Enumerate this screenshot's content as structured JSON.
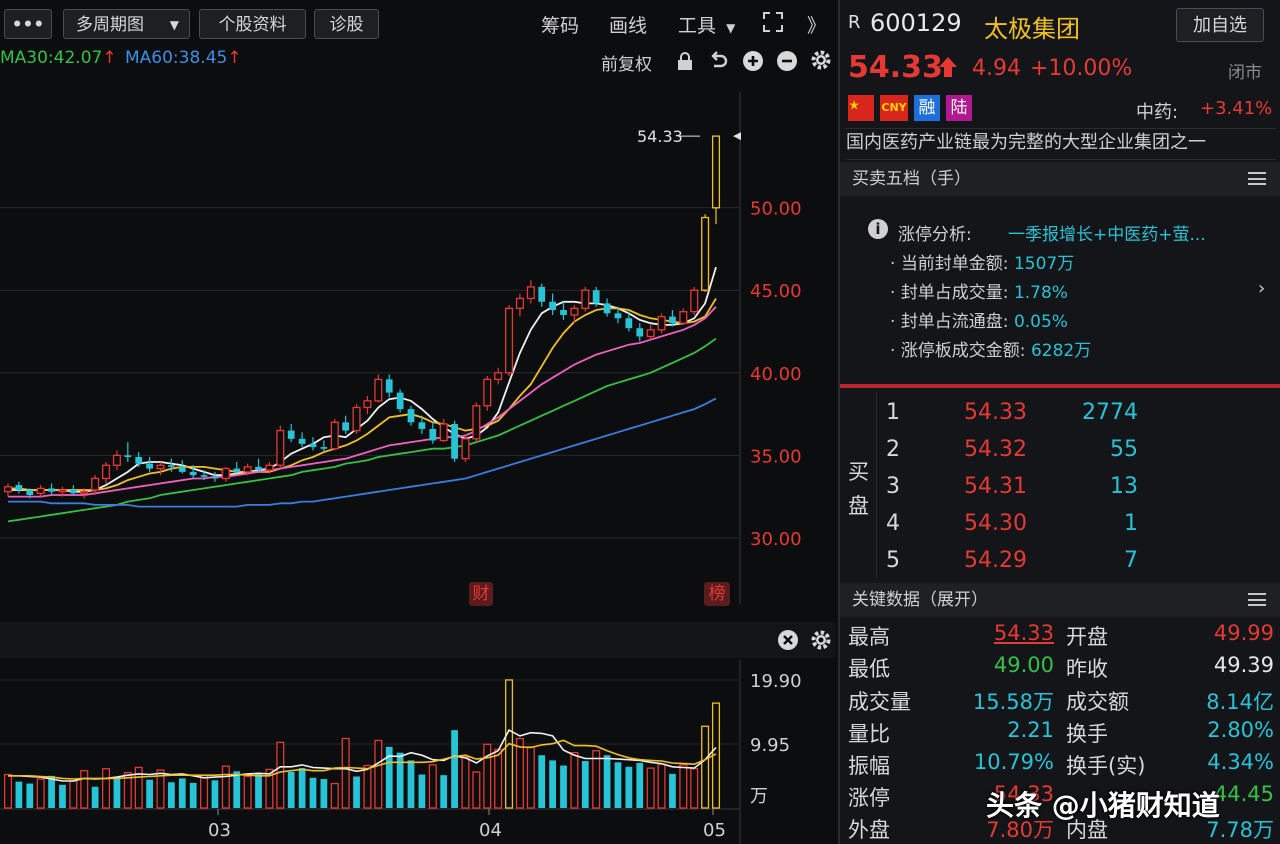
{
  "toolbar": {
    "more_label": "•••",
    "period_label": "多周期图",
    "stock_info_label": "个股资料",
    "diagnose_label": "诊股",
    "chips_label": "筹码",
    "draw_label": "画线",
    "tools_label": "工具",
    "expand_label": "》"
  },
  "ma_legend": {
    "ma30": "MA30:42.07",
    "ma60": "MA60:38.45"
  },
  "chart_controls": {
    "adjust_label": "前复权"
  },
  "markers": {
    "cai": "财",
    "bang": "榜"
  },
  "chart_data": [
    {
      "type": "candlestick",
      "title": "",
      "ylim": [
        26,
        57
      ],
      "y_ticks": [
        "30.00",
        "35.00",
        "40.00",
        "45.00",
        "50.00"
      ],
      "last_price_label": "54.33",
      "candles": [
        [
          32.8,
          33.3,
          32.5,
          33.1
        ],
        [
          33.2,
          33.4,
          32.7,
          32.9
        ],
        [
          32.9,
          33.0,
          32.4,
          32.6
        ],
        [
          32.7,
          33.2,
          32.5,
          33.0
        ],
        [
          33.0,
          33.3,
          32.6,
          32.8
        ],
        [
          32.8,
          33.1,
          32.5,
          32.9
        ],
        [
          32.9,
          33.2,
          32.6,
          32.7
        ],
        [
          32.7,
          33.0,
          32.4,
          32.8
        ],
        [
          32.9,
          33.8,
          32.6,
          33.6
        ],
        [
          33.6,
          34.6,
          33.3,
          34.4
        ],
        [
          34.4,
          35.3,
          34.1,
          35.0
        ],
        [
          35.0,
          35.8,
          34.6,
          34.9
        ],
        [
          34.9,
          35.2,
          34.3,
          34.5
        ],
        [
          34.5,
          34.9,
          34.0,
          34.2
        ],
        [
          34.2,
          34.6,
          33.8,
          34.4
        ],
        [
          34.4,
          34.8,
          34.0,
          34.3
        ],
        [
          34.3,
          34.7,
          33.9,
          34.0
        ],
        [
          34.0,
          34.4,
          33.6,
          33.8
        ],
        [
          33.8,
          34.1,
          33.5,
          33.7
        ],
        [
          33.7,
          34.0,
          33.4,
          33.6
        ],
        [
          33.6,
          34.3,
          33.4,
          34.2
        ],
        [
          34.2,
          34.6,
          33.9,
          34.0
        ],
        [
          34.0,
          34.5,
          33.8,
          34.3
        ],
        [
          34.3,
          34.8,
          34.0,
          34.1
        ],
        [
          34.1,
          34.6,
          33.9,
          34.4
        ],
        [
          34.4,
          36.8,
          34.2,
          36.5
        ],
        [
          36.5,
          36.9,
          35.8,
          36.0
        ],
        [
          36.0,
          36.4,
          35.5,
          35.7
        ],
        [
          35.7,
          36.1,
          35.3,
          35.5
        ],
        [
          35.5,
          35.9,
          35.2,
          35.4
        ],
        [
          35.4,
          37.2,
          35.3,
          37.0
        ],
        [
          37.0,
          37.4,
          36.3,
          36.5
        ],
        [
          36.5,
          38.1,
          36.3,
          37.9
        ],
        [
          37.9,
          38.6,
          37.5,
          38.3
        ],
        [
          38.3,
          39.9,
          38.2,
          39.6
        ],
        [
          39.6,
          39.9,
          38.5,
          38.8
        ],
        [
          38.8,
          39.0,
          37.6,
          37.8
        ],
        [
          37.8,
          38.0,
          36.8,
          37.0
        ],
        [
          37.0,
          37.4,
          36.3,
          36.6
        ],
        [
          36.6,
          37.0,
          35.7,
          35.9
        ],
        [
          35.9,
          37.2,
          35.8,
          36.9
        ],
        [
          36.9,
          37.1,
          34.6,
          34.8
        ],
        [
          34.8,
          36.2,
          34.6,
          36.0
        ],
        [
          36.0,
          38.2,
          35.8,
          38.0
        ],
        [
          38.0,
          39.8,
          37.7,
          39.6
        ],
        [
          39.6,
          40.3,
          39.3,
          40.0
        ],
        [
          40.0,
          44.1,
          39.8,
          43.9
        ],
        [
          43.9,
          44.8,
          43.4,
          44.5
        ],
        [
          44.5,
          45.6,
          44.2,
          45.2
        ],
        [
          45.2,
          45.4,
          44.0,
          44.3
        ],
        [
          44.3,
          44.8,
          43.5,
          43.8
        ],
        [
          43.8,
          44.3,
          43.2,
          43.5
        ],
        [
          43.5,
          44.1,
          43.0,
          43.9
        ],
        [
          43.9,
          45.2,
          43.7,
          45.0
        ],
        [
          45.0,
          45.2,
          44.0,
          44.2
        ],
        [
          44.2,
          44.5,
          43.4,
          43.6
        ],
        [
          43.6,
          44.0,
          43.0,
          43.3
        ],
        [
          43.3,
          43.7,
          42.5,
          42.7
        ],
        [
          42.7,
          43.0,
          41.9,
          42.2
        ],
        [
          42.2,
          42.9,
          42.0,
          42.6
        ],
        [
          42.6,
          43.6,
          42.4,
          43.4
        ],
        [
          43.4,
          43.8,
          42.8,
          43.0
        ],
        [
          43.0,
          43.9,
          42.9,
          43.7
        ],
        [
          43.7,
          45.2,
          43.5,
          45.0
        ],
        [
          45.0,
          49.6,
          44.9,
          49.4
        ],
        [
          49.99,
          54.33,
          49.0,
          54.33
        ]
      ],
      "series": [
        {
          "name": "MA5",
          "color": "#f0f0f0",
          "values": [
            32.9,
            32.9,
            32.9,
            32.9,
            32.9,
            32.9,
            32.8,
            32.8,
            32.9,
            33.2,
            33.6,
            34.0,
            34.5,
            34.6,
            34.6,
            34.5,
            34.4,
            34.2,
            34.0,
            33.8,
            33.8,
            33.9,
            34.0,
            34.1,
            34.2,
            34.6,
            35.1,
            35.4,
            35.7,
            36.1,
            36.2,
            36.1,
            36.6,
            37.1,
            37.9,
            38.4,
            38.5,
            38.3,
            37.8,
            37.2,
            36.7,
            36.3,
            36.0,
            36.2,
            36.7,
            37.6,
            39.4,
            41.2,
            42.6,
            43.6,
            44.0,
            44.3,
            44.3,
            44.2,
            44.2,
            44.1,
            43.9,
            43.6,
            43.2,
            43.0,
            42.9,
            42.9,
            43.0,
            43.3,
            44.2,
            46.4
          ]
        },
        {
          "name": "MA10",
          "color": "#f0c020",
          "values": [
            33.0,
            33.0,
            32.9,
            32.9,
            32.9,
            32.9,
            32.9,
            32.9,
            32.9,
            33.0,
            33.2,
            33.5,
            33.7,
            33.9,
            34.0,
            34.2,
            34.3,
            34.3,
            34.3,
            34.2,
            34.1,
            34.0,
            34.0,
            34.0,
            34.0,
            34.2,
            34.4,
            34.7,
            34.9,
            35.2,
            35.4,
            35.6,
            35.9,
            36.3,
            36.8,
            37.3,
            37.4,
            37.5,
            37.3,
            37.0,
            36.9,
            36.7,
            36.5,
            36.6,
            36.8,
            37.1,
            37.8,
            38.6,
            39.3,
            40.4,
            41.5,
            42.4,
            43.1,
            43.5,
            43.8,
            43.9,
            43.9,
            43.8,
            43.5,
            43.3,
            43.2,
            43.1,
            43.0,
            43.1,
            43.4,
            44.5
          ]
        },
        {
          "name": "MA20",
          "color": "#f060c0",
          "values": [
            32.5,
            32.5,
            32.5,
            32.5,
            32.6,
            32.6,
            32.6,
            32.6,
            32.7,
            32.8,
            32.9,
            33.0,
            33.1,
            33.2,
            33.3,
            33.4,
            33.5,
            33.6,
            33.6,
            33.7,
            33.7,
            33.8,
            33.9,
            34.0,
            34.1,
            34.2,
            34.3,
            34.4,
            34.5,
            34.6,
            34.7,
            34.8,
            35.0,
            35.2,
            35.4,
            35.6,
            35.7,
            35.8,
            35.9,
            36.0,
            36.1,
            36.1,
            36.2,
            36.5,
            36.9,
            37.3,
            37.8,
            38.3,
            38.8,
            39.3,
            39.7,
            40.1,
            40.5,
            40.8,
            41.1,
            41.3,
            41.5,
            41.7,
            41.8,
            42.0,
            42.2,
            42.4,
            42.6,
            42.9,
            43.3,
            44.0
          ]
        },
        {
          "name": "MA30",
          "color": "#35c146",
          "values": [
            31.0,
            31.1,
            31.2,
            31.3,
            31.4,
            31.5,
            31.6,
            31.7,
            31.8,
            31.9,
            32.0,
            32.2,
            32.3,
            32.4,
            32.6,
            32.7,
            32.8,
            32.9,
            33.0,
            33.1,
            33.2,
            33.3,
            33.4,
            33.5,
            33.6,
            33.7,
            33.8,
            34.0,
            34.1,
            34.2,
            34.3,
            34.5,
            34.6,
            34.7,
            34.9,
            35.0,
            35.1,
            35.2,
            35.3,
            35.4,
            35.4,
            35.5,
            35.6,
            35.8,
            36.0,
            36.2,
            36.5,
            36.8,
            37.1,
            37.4,
            37.7,
            38.0,
            38.3,
            38.6,
            38.9,
            39.2,
            39.4,
            39.6,
            39.8,
            40.0,
            40.3,
            40.6,
            40.9,
            41.2,
            41.6,
            42.07
          ]
        },
        {
          "name": "MA60",
          "color": "#3a7de0",
          "values": [
            32.2,
            32.2,
            32.2,
            32.2,
            32.1,
            32.1,
            32.1,
            32.1,
            32.0,
            32.0,
            32.0,
            32.0,
            31.9,
            31.9,
            31.9,
            31.9,
            31.9,
            31.9,
            31.9,
            31.9,
            31.9,
            31.9,
            32.0,
            32.0,
            32.0,
            32.1,
            32.1,
            32.2,
            32.2,
            32.3,
            32.4,
            32.5,
            32.6,
            32.7,
            32.8,
            32.9,
            33.0,
            33.1,
            33.2,
            33.3,
            33.4,
            33.5,
            33.6,
            33.8,
            34.0,
            34.2,
            34.4,
            34.6,
            34.8,
            35.0,
            35.2,
            35.4,
            35.6,
            35.8,
            36.0,
            36.2,
            36.4,
            36.6,
            36.8,
            37.0,
            37.2,
            37.4,
            37.6,
            37.8,
            38.1,
            38.45
          ]
        }
      ]
    },
    {
      "type": "bar",
      "title": "",
      "ylim": [
        0,
        23
      ],
      "y_ticks": [
        "9.95",
        "19.90"
      ],
      "unit_label": "万",
      "x_ticks": [
        "03",
        "04",
        "05"
      ],
      "values": [
        5.2,
        4.1,
        3.8,
        4.5,
        5.0,
        3.6,
        4.2,
        5.8,
        3.3,
        6.1,
        4.8,
        5.5,
        6.3,
        4.4,
        5.9,
        4.0,
        4.6,
        3.9,
        5.1,
        4.3,
        6.5,
        5.7,
        4.9,
        5.3,
        6.0,
        10.2,
        5.6,
        6.2,
        4.7,
        4.5,
        3.8,
        10.8,
        4.9,
        6.6,
        10.5,
        9.5,
        8.6,
        7.4,
        5.2,
        6.7,
        5.1,
        12.1,
        7.9,
        5.6,
        9.9,
        9.1,
        19.9,
        10.8,
        9.5,
        8.2,
        7.4,
        6.6,
        8.6,
        7.3,
        8.9,
        8.2,
        7.1,
        6.4,
        7.0,
        6.2,
        6.8,
        5.3,
        6.7,
        6.1,
        12.7,
        16.3
      ],
      "up_flags": [
        1,
        0,
        0,
        1,
        0,
        0,
        1,
        1,
        0,
        1,
        0,
        1,
        1,
        0,
        1,
        0,
        0,
        0,
        1,
        0,
        1,
        0,
        1,
        0,
        1,
        1,
        0,
        0,
        0,
        0,
        1,
        1,
        0,
        1,
        1,
        0,
        0,
        0,
        0,
        1,
        0,
        0,
        1,
        1,
        1,
        1,
        1,
        1,
        1,
        0,
        0,
        0,
        1,
        0,
        1,
        0,
        0,
        0,
        0,
        1,
        1,
        0,
        1,
        1,
        1,
        1
      ],
      "series": [
        {
          "name": "VMA5",
          "color": "#f0f0f0",
          "values": [
            5.0,
            5.0,
            4.9,
            4.8,
            4.5,
            4.2,
            4.2,
            4.6,
            4.5,
            4.6,
            4.8,
            5.1,
            5.3,
            5.2,
            5.4,
            5.2,
            5.3,
            5.0,
            4.7,
            4.8,
            4.9,
            5.1,
            5.3,
            5.4,
            5.3,
            6.4,
            6.4,
            6.7,
            6.3,
            6.2,
            6.1,
            6.1,
            5.7,
            6.0,
            7.0,
            8.1,
            8.0,
            8.6,
            8.2,
            7.5,
            7.4,
            8.1,
            7.8,
            7.0,
            8.1,
            8.9,
            12.1,
            11.2,
            11.7,
            11.6,
            11.2,
            9.0,
            8.2,
            7.7,
            7.7,
            7.7,
            7.6,
            7.5,
            7.4,
            7.1,
            6.9,
            6.4,
            6.3,
            6.2,
            7.5,
            9.4
          ]
        },
        {
          "name": "VMA10",
          "color": "#f0c020",
          "values": [
            5.0,
            5.0,
            5.0,
            4.9,
            4.8,
            4.6,
            4.5,
            4.6,
            4.6,
            4.6,
            4.6,
            4.7,
            4.8,
            4.9,
            5.0,
            5.1,
            5.1,
            5.1,
            5.1,
            5.1,
            5.2,
            5.2,
            5.1,
            5.0,
            5.0,
            5.6,
            5.8,
            6.0,
            5.8,
            5.8,
            6.2,
            6.3,
            6.2,
            6.1,
            6.6,
            7.1,
            7.1,
            7.1,
            7.1,
            7.2,
            7.6,
            8.0,
            8.2,
            7.6,
            7.8,
            8.2,
            10.0,
            9.5,
            9.4,
            9.8,
            10.0,
            10.5,
            9.7,
            9.7,
            9.6,
            8.9,
            8.3,
            7.8,
            7.5,
            7.4,
            7.3,
            7.0,
            6.9,
            6.8,
            7.5,
            8.4
          ]
        }
      ]
    }
  ],
  "quote": {
    "r_label": "R",
    "code": "600129",
    "name": "太极集团",
    "add_watch_label": "加自选",
    "price": "54.33",
    "up_arrow": "🡅",
    "change": "4.94",
    "change_pct": "+10.00%",
    "status": "闭市",
    "tag_cny": "CNY",
    "tag_rong": "融",
    "tag_lu": "陆",
    "sector_label": "中药:",
    "sector_pct": "+3.41%",
    "description": "国内医药产业链最为完整的大型企业集团之一"
  },
  "orderbook": {
    "title": "买卖五档（手）",
    "limit_analysis": {
      "label": "涨停分析:",
      "reason": "一季报增长+中医药+萤...",
      "rows": [
        {
          "label": "当前封单金额:",
          "value": "1507万"
        },
        {
          "label": "封单占成交量:",
          "value": "1.78%"
        },
        {
          "label": "封单占流通盘:",
          "value": "0.05%"
        },
        {
          "label": "涨停板成交金额:",
          "value": "6282万"
        }
      ]
    },
    "buy_label_1": "买",
    "buy_label_2": "盘",
    "bids": [
      {
        "level": "1",
        "price": "54.33",
        "volume": "2774"
      },
      {
        "level": "2",
        "price": "54.32",
        "volume": "55"
      },
      {
        "level": "3",
        "price": "54.31",
        "volume": "13"
      },
      {
        "level": "4",
        "price": "54.30",
        "volume": "1"
      },
      {
        "level": "5",
        "price": "54.29",
        "volume": "7"
      }
    ]
  },
  "key_data": {
    "title": "关键数据（展开）",
    "high_label": "最高",
    "high": "54.33",
    "open_label": "开盘",
    "open": "49.99",
    "low_label": "最低",
    "low": "49.00",
    "prev_close_label": "昨收",
    "prev_close": "49.39",
    "volume_label": "成交量",
    "volume": "15.58万",
    "amount_label": "成交额",
    "amount": "8.14亿",
    "vol_ratio_label": "量比",
    "vol_ratio": "2.21",
    "turnover_label": "换手",
    "turnover": "2.80%",
    "amplitude_label": "振幅",
    "amplitude": "10.79%",
    "turnover_real_label": "换手(实)",
    "turnover_real": "4.34%",
    "limit_up_label": "涨停",
    "limit_up": "54.33",
    "limit_down": "44.45",
    "outer_label": "外盘",
    "outer": "7.80万",
    "inner_label": "内盘",
    "inner": "7.78万"
  },
  "watermark": "头条 @小猪财知道",
  "colors": {
    "up": "#e53935",
    "down": "#27c3d6",
    "limit_up": "#f0c020",
    "bg": "#0c0d0f"
  }
}
